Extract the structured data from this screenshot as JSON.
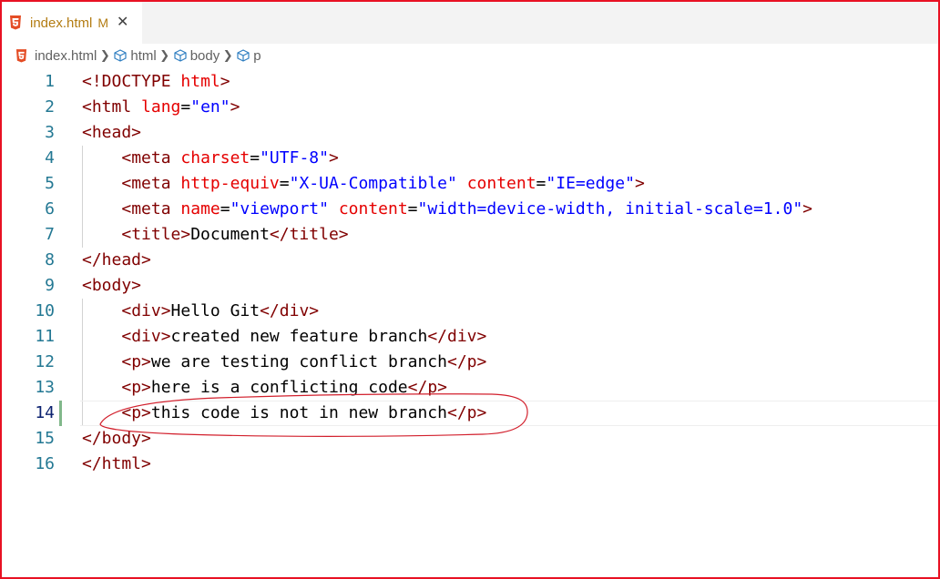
{
  "tab": {
    "filename": "index.html",
    "status": "M",
    "close_icon": "close-icon",
    "file_icon": "html5-icon"
  },
  "breadcrumb": {
    "items": [
      "index.html",
      "html",
      "body",
      "p"
    ],
    "separator_icon": "chevron-right-icon",
    "element_icon": "symbol-element-icon"
  },
  "colors": {
    "tag": "#800000",
    "attribute": "#e50000",
    "string": "#0000ff",
    "text": "#000000",
    "line_number": "#237893",
    "modified_tab": "#b37c12",
    "git_modified_gutter": "#81b88b",
    "frame": "#e81123",
    "annotation": "#d21f2c"
  },
  "editor": {
    "lines": [
      {
        "num": "1",
        "tokens": [
          [
            "t",
            "<!DOCTYPE"
          ],
          [
            "x",
            " "
          ],
          [
            "a",
            "html"
          ],
          [
            "t",
            ">"
          ]
        ]
      },
      {
        "num": "2",
        "tokens": [
          [
            "t",
            "<html"
          ],
          [
            "x",
            " "
          ],
          [
            "a",
            "lang"
          ],
          [
            "x",
            "="
          ],
          [
            "s",
            "\"en\""
          ],
          [
            "t",
            ">"
          ]
        ]
      },
      {
        "num": "3",
        "tokens": [
          [
            "t",
            "<head>"
          ]
        ]
      },
      {
        "num": "4",
        "tokens": [
          [
            "x",
            "    "
          ],
          [
            "t",
            "<meta"
          ],
          [
            "x",
            " "
          ],
          [
            "a",
            "charset"
          ],
          [
            "x",
            "="
          ],
          [
            "s",
            "\"UTF-8\""
          ],
          [
            "t",
            ">"
          ]
        ]
      },
      {
        "num": "5",
        "tokens": [
          [
            "x",
            "    "
          ],
          [
            "t",
            "<meta"
          ],
          [
            "x",
            " "
          ],
          [
            "a",
            "http-equiv"
          ],
          [
            "x",
            "="
          ],
          [
            "s",
            "\"X-UA-Compatible\""
          ],
          [
            "x",
            " "
          ],
          [
            "a",
            "content"
          ],
          [
            "x",
            "="
          ],
          [
            "s",
            "\"IE=edge\""
          ],
          [
            "t",
            ">"
          ]
        ]
      },
      {
        "num": "6",
        "tokens": [
          [
            "x",
            "    "
          ],
          [
            "t",
            "<meta"
          ],
          [
            "x",
            " "
          ],
          [
            "a",
            "name"
          ],
          [
            "x",
            "="
          ],
          [
            "s",
            "\"viewport\""
          ],
          [
            "x",
            " "
          ],
          [
            "a",
            "content"
          ],
          [
            "x",
            "="
          ],
          [
            "s",
            "\"width=device-width, initial-scale=1.0\""
          ],
          [
            "t",
            ">"
          ]
        ]
      },
      {
        "num": "7",
        "tokens": [
          [
            "x",
            "    "
          ],
          [
            "t",
            "<title>"
          ],
          [
            "x",
            "Document"
          ],
          [
            "t",
            "</title>"
          ]
        ]
      },
      {
        "num": "8",
        "tokens": [
          [
            "t",
            "</head>"
          ]
        ]
      },
      {
        "num": "9",
        "tokens": [
          [
            "t",
            "<body>"
          ]
        ]
      },
      {
        "num": "10",
        "tokens": [
          [
            "x",
            "    "
          ],
          [
            "t",
            "<div>"
          ],
          [
            "x",
            "Hello Git"
          ],
          [
            "t",
            "</div>"
          ]
        ]
      },
      {
        "num": "11",
        "tokens": [
          [
            "x",
            "    "
          ],
          [
            "t",
            "<div>"
          ],
          [
            "x",
            "created new feature branch"
          ],
          [
            "t",
            "</div>"
          ]
        ]
      },
      {
        "num": "12",
        "tokens": [
          [
            "x",
            "    "
          ],
          [
            "t",
            "<p>"
          ],
          [
            "x",
            "we are testing conflict branch"
          ],
          [
            "t",
            "</p>"
          ]
        ]
      },
      {
        "num": "13",
        "tokens": [
          [
            "x",
            "    "
          ],
          [
            "t",
            "<p>"
          ],
          [
            "x",
            "here is a conflicting code"
          ],
          [
            "t",
            "</p>"
          ]
        ]
      },
      {
        "num": "14",
        "tokens": [
          [
            "x",
            "    "
          ],
          [
            "t",
            "<p>"
          ],
          [
            "x",
            "this code is not in new branch"
          ],
          [
            "t",
            "</p>"
          ]
        ],
        "current": true,
        "modified": true
      },
      {
        "num": "15",
        "tokens": [
          [
            "t",
            "</body>"
          ]
        ]
      },
      {
        "num": "16",
        "tokens": [
          [
            "t",
            "</html>"
          ]
        ]
      }
    ]
  }
}
